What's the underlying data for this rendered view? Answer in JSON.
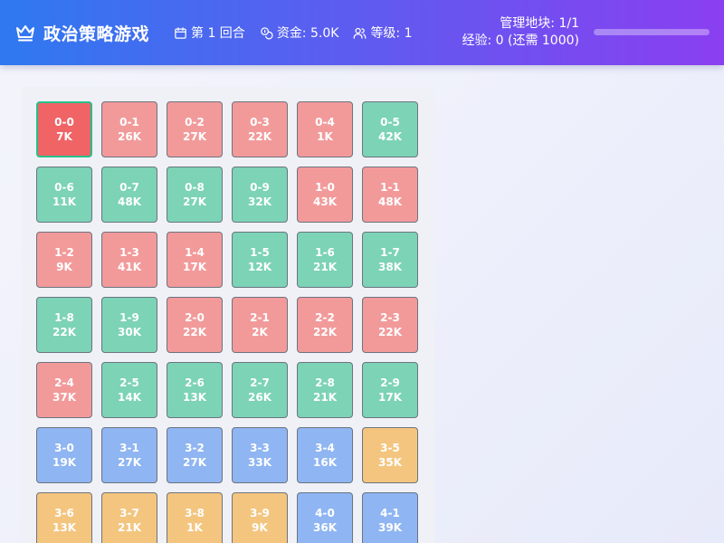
{
  "header": {
    "title": "政治策略游戏",
    "title_icon": "crown-icon",
    "stats": [
      {
        "icon": "calendar-icon",
        "label": "第 1 回合"
      },
      {
        "icon": "coins-icon",
        "label": "资金: 5.0K"
      },
      {
        "icon": "users-icon",
        "label": "等级: 1"
      }
    ],
    "territory": "管理地块: 1/1",
    "experience": "经验: 0 (还需 1000)",
    "experience_progress": 0
  },
  "colors": {
    "selected": "#f06466",
    "red": "#f29a9a",
    "green": "#7cd3b6",
    "blue": "#8fb5f2",
    "orange": "#f4c57f",
    "selected_border": "#27c08b"
  },
  "board": {
    "columns": 6,
    "tiles": [
      {
        "id": "0-0",
        "value": "7K",
        "color": "selected"
      },
      {
        "id": "0-1",
        "value": "26K",
        "color": "red"
      },
      {
        "id": "0-2",
        "value": "27K",
        "color": "red"
      },
      {
        "id": "0-3",
        "value": "22K",
        "color": "red"
      },
      {
        "id": "0-4",
        "value": "1K",
        "color": "red"
      },
      {
        "id": "0-5",
        "value": "42K",
        "color": "green"
      },
      {
        "id": "0-6",
        "value": "11K",
        "color": "green"
      },
      {
        "id": "0-7",
        "value": "48K",
        "color": "green"
      },
      {
        "id": "0-8",
        "value": "27K",
        "color": "green"
      },
      {
        "id": "0-9",
        "value": "32K",
        "color": "green"
      },
      {
        "id": "1-0",
        "value": "43K",
        "color": "red"
      },
      {
        "id": "1-1",
        "value": "48K",
        "color": "red"
      },
      {
        "id": "1-2",
        "value": "9K",
        "color": "red"
      },
      {
        "id": "1-3",
        "value": "41K",
        "color": "red"
      },
      {
        "id": "1-4",
        "value": "17K",
        "color": "red"
      },
      {
        "id": "1-5",
        "value": "12K",
        "color": "green"
      },
      {
        "id": "1-6",
        "value": "21K",
        "color": "green"
      },
      {
        "id": "1-7",
        "value": "38K",
        "color": "green"
      },
      {
        "id": "1-8",
        "value": "22K",
        "color": "green"
      },
      {
        "id": "1-9",
        "value": "30K",
        "color": "green"
      },
      {
        "id": "2-0",
        "value": "22K",
        "color": "red"
      },
      {
        "id": "2-1",
        "value": "2K",
        "color": "red"
      },
      {
        "id": "2-2",
        "value": "22K",
        "color": "red"
      },
      {
        "id": "2-3",
        "value": "22K",
        "color": "red"
      },
      {
        "id": "2-4",
        "value": "37K",
        "color": "red"
      },
      {
        "id": "2-5",
        "value": "14K",
        "color": "green"
      },
      {
        "id": "2-6",
        "value": "13K",
        "color": "green"
      },
      {
        "id": "2-7",
        "value": "26K",
        "color": "green"
      },
      {
        "id": "2-8",
        "value": "21K",
        "color": "green"
      },
      {
        "id": "2-9",
        "value": "17K",
        "color": "green"
      },
      {
        "id": "3-0",
        "value": "19K",
        "color": "blue"
      },
      {
        "id": "3-1",
        "value": "27K",
        "color": "blue"
      },
      {
        "id": "3-2",
        "value": "27K",
        "color": "blue"
      },
      {
        "id": "3-3",
        "value": "33K",
        "color": "blue"
      },
      {
        "id": "3-4",
        "value": "16K",
        "color": "blue"
      },
      {
        "id": "3-5",
        "value": "35K",
        "color": "orange"
      },
      {
        "id": "3-6",
        "value": "13K",
        "color": "orange"
      },
      {
        "id": "3-7",
        "value": "21K",
        "color": "orange"
      },
      {
        "id": "3-8",
        "value": "1K",
        "color": "orange"
      },
      {
        "id": "3-9",
        "value": "9K",
        "color": "orange"
      },
      {
        "id": "4-0",
        "value": "36K",
        "color": "blue"
      },
      {
        "id": "4-1",
        "value": "39K",
        "color": "blue"
      }
    ]
  }
}
